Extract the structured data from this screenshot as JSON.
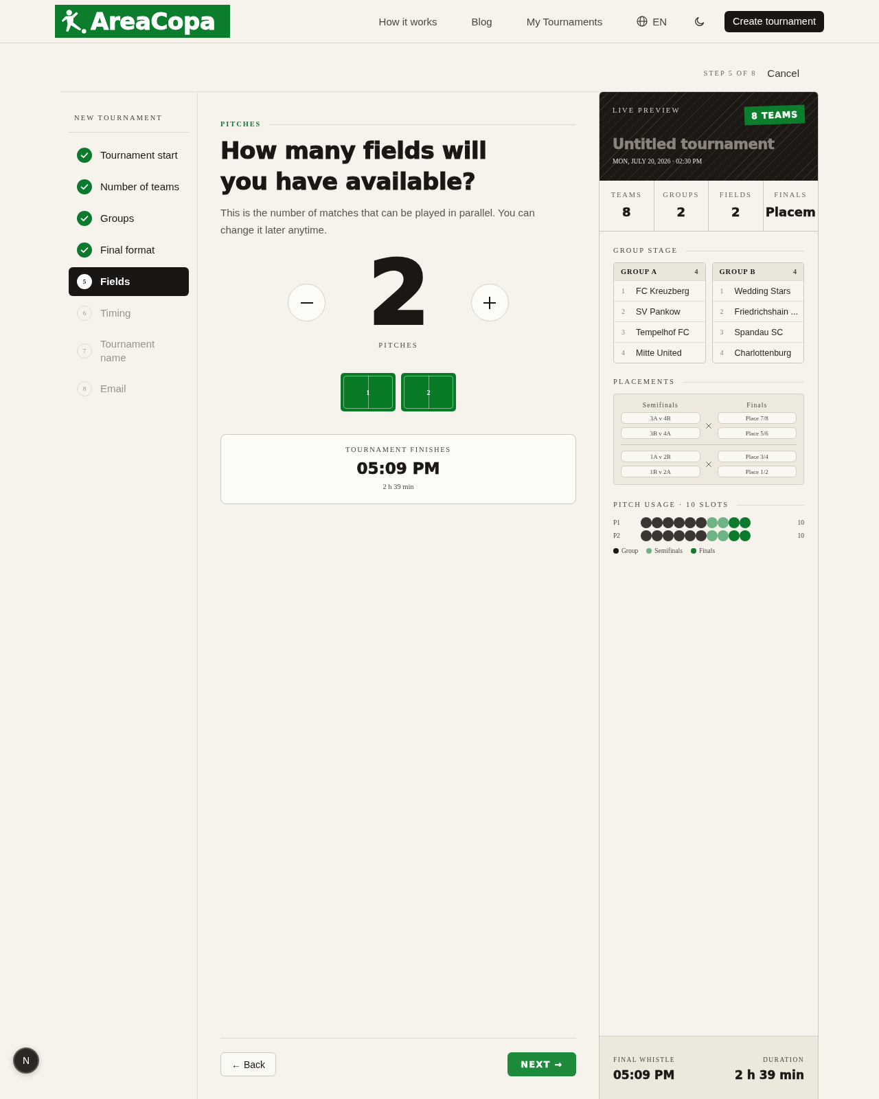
{
  "header": {
    "logo": "AreaCopa",
    "nav": [
      {
        "label": "How it works"
      },
      {
        "label": "Blog"
      },
      {
        "label": "My Tournaments"
      }
    ],
    "language": "EN",
    "cta": "Create tournament"
  },
  "wizard": {
    "step": "STEP 5 OF 8",
    "cancel": "Cancel"
  },
  "sidebar": {
    "title": "NEW TOURNAMENT",
    "steps": [
      {
        "label": "Tournament start",
        "done": true,
        "selected": false
      },
      {
        "label": "Number of teams",
        "done": true,
        "selected": false
      },
      {
        "label": "Groups",
        "done": true,
        "selected": false
      },
      {
        "label": "Final format",
        "done": true,
        "selected": false
      },
      {
        "label": "Fields",
        "number": "5",
        "done": false,
        "selected": true
      },
      {
        "label": "Timing",
        "number": "6",
        "done": false,
        "selected": false
      },
      {
        "label": "Tournament name",
        "number": "7",
        "done": false,
        "selected": false
      },
      {
        "label": "Email",
        "number": "8",
        "done": false,
        "selected": false
      }
    ]
  },
  "question": {
    "section": "PITCHES",
    "title": "How many fields will you have available?",
    "description": "This is the number of matches that can be played in parallel. You can change it later anytime.",
    "counter": {
      "value": "2",
      "unit": "PITCHES"
    },
    "pitches": [
      "1",
      "2"
    ],
    "finish": {
      "label": "TOURNAMENT FINISHES",
      "time": "05:09 PM",
      "duration": "2 h 39 min"
    }
  },
  "navigation": {
    "back": "← Back",
    "next": "NEXT →"
  },
  "preview": {
    "label": "LIVE PREVIEW",
    "badge": "8 TEAMS",
    "title": "Untitled tournament",
    "date": "MON, JULY 20, 2026 · 02:30 PM",
    "stats": [
      {
        "label": "TEAMS",
        "value": "8"
      },
      {
        "label": "GROUPS",
        "value": "2"
      },
      {
        "label": "FIELDS",
        "value": "2"
      },
      {
        "label": "FINALS",
        "value": "Placem"
      }
    ],
    "group_stage": {
      "title": "GROUP STAGE",
      "groups": [
        {
          "name": "GROUP A",
          "count": "4",
          "teams": [
            {
              "rank": "1",
              "name": "FC Kreuzberg"
            },
            {
              "rank": "2",
              "name": "SV Pankow"
            },
            {
              "rank": "3",
              "name": "Tempelhof FC"
            },
            {
              "rank": "4",
              "name": "Mitte United"
            }
          ]
        },
        {
          "name": "GROUP B",
          "count": "4",
          "teams": [
            {
              "rank": "1",
              "name": "Wedding Stars"
            },
            {
              "rank": "2",
              "name": "Friedrichshain ..."
            },
            {
              "rank": "3",
              "name": "Spandau SC"
            },
            {
              "rank": "4",
              "name": "Charlottenburg"
            }
          ]
        }
      ]
    },
    "placements": {
      "title": "PLACEMENTS",
      "columns": [
        "Semifinals",
        "Finals"
      ],
      "brackets": [
        {
          "semifinals": [
            "3A v 4B",
            "3B v 4A"
          ],
          "finals": [
            "Place 7/8",
            "Place 5/6"
          ]
        },
        {
          "semifinals": [
            "1A v 2B",
            "1B v 2A"
          ],
          "finals": [
            "Place 3/4",
            "Place 1/2"
          ]
        }
      ]
    },
    "pitch_usage": {
      "title": "PITCH USAGE · 10 SLOTS",
      "rows": [
        {
          "label": "P1",
          "count": "10",
          "slots": [
            {
              "color": "#3a3531"
            },
            {
              "color": "#3a3531"
            },
            {
              "color": "#3a3531"
            },
            {
              "color": "#3a3531"
            },
            {
              "color": "#3a3531"
            },
            {
              "color": "#3a3531"
            },
            {
              "color": "#6db383"
            },
            {
              "color": "#6db383"
            },
            {
              "color": "#0b7a2c"
            },
            {
              "color": "#0b7a2c"
            }
          ]
        },
        {
          "label": "P2",
          "count": "10",
          "slots": [
            {
              "color": "#3a3531"
            },
            {
              "color": "#3a3531"
            },
            {
              "color": "#3a3531"
            },
            {
              "color": "#3a3531"
            },
            {
              "color": "#3a3531"
            },
            {
              "color": "#3a3531"
            },
            {
              "color": "#6db383"
            },
            {
              "color": "#6db383"
            },
            {
              "color": "#0b7a2c"
            },
            {
              "color": "#0b7a2c"
            }
          ]
        }
      ],
      "legend": [
        {
          "label": "Group",
          "color": "#1a1613"
        },
        {
          "label": "Semifinals",
          "color": "#6db383"
        },
        {
          "label": "Finals",
          "color": "#0b7a2c"
        }
      ]
    },
    "footer": {
      "finish_label": "FINAL WHISTLE",
      "finish_value": "05:09 PM",
      "duration_label": "DURATION",
      "duration_value": "2 h 39 min"
    }
  },
  "dev_button": {
    "label": "N"
  }
}
